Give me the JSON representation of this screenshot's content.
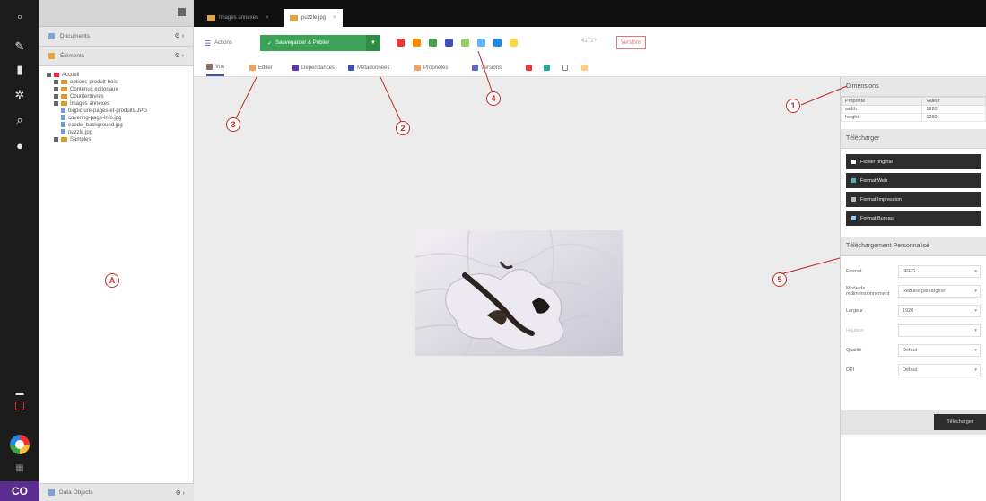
{
  "rail": {
    "icons": [
      "file-icon",
      "wrench-icon",
      "chart-icon",
      "gear-icon",
      "search-icon",
      "eye-icon"
    ]
  },
  "tree": {
    "documents_label": "Documents",
    "elements_label": "Éléments",
    "objects_label": "Data Objects",
    "panel_controls": "⚙ ›",
    "items": [
      {
        "label": "Accueil",
        "kind": "home",
        "depth": 0
      },
      {
        "label": "options-produit-bois",
        "kind": "folder",
        "depth": 1
      },
      {
        "label": "Contenus editoriaux",
        "kind": "folder",
        "depth": 1
      },
      {
        "label": "Countertuvres",
        "kind": "folder",
        "depth": 1
      },
      {
        "label": "Images annexes",
        "kind": "folder",
        "depth": 1
      },
      {
        "label": "bigpicture-pages-et-produits.JPG",
        "kind": "image",
        "depth": 2
      },
      {
        "label": "covering-page-info.jpg",
        "kind": "image",
        "depth": 2
      },
      {
        "label": "ecode_background.jpg",
        "kind": "image",
        "depth": 2
      },
      {
        "label": "puzzle.jpg",
        "kind": "image",
        "depth": 2
      },
      {
        "label": "Samples",
        "kind": "folder",
        "depth": 1
      }
    ]
  },
  "tabs": [
    {
      "label": "Images annexes"
    },
    {
      "label": "puzzle.jpg"
    }
  ],
  "toolbar": {
    "actions_label": "Actions",
    "save_label": "Sauvegarder & Publier",
    "dim_text": "4172?",
    "versions_label": "Versions"
  },
  "subtabs": [
    {
      "label": "Vue"
    },
    {
      "label": "Editer"
    },
    {
      "label": "Dépendances"
    },
    {
      "label": "Métadonnées"
    },
    {
      "label": "Propriétés"
    },
    {
      "label": "Versions"
    }
  ],
  "callouts": [
    "1",
    "2",
    "3",
    "4",
    "5",
    "A"
  ],
  "right": {
    "dimensions_title": "Dimensions",
    "col_property": "Propriété",
    "col_value": "Valeur",
    "rows": [
      {
        "property": "width",
        "value": "1920"
      },
      {
        "property": "height",
        "value": "1280"
      }
    ],
    "download_title": "Télécharger",
    "download_buttons": [
      "Fichier original",
      "Format Web",
      "Format Impression",
      "Format Bureau"
    ],
    "custom_title": "Téléchargement Personnalisé",
    "fields": [
      {
        "label": "Format",
        "value": "JPEG",
        "disabled": false
      },
      {
        "label": "Mode de redimensionnement",
        "value": "Réduire par largeur",
        "disabled": false
      },
      {
        "label": "Largeur",
        "value": "1920",
        "disabled": false
      },
      {
        "label": "Hauteur",
        "value": "",
        "disabled": true
      },
      {
        "label": "Qualité",
        "value": "Défaut",
        "disabled": false
      },
      {
        "label": "DPI",
        "value": "Défaut",
        "disabled": false
      }
    ],
    "download_action": "Télécharger"
  },
  "colors": {
    "save_green": "#3aa356",
    "accent_blue": "#3f51b5",
    "callout_red": "#c62828"
  }
}
